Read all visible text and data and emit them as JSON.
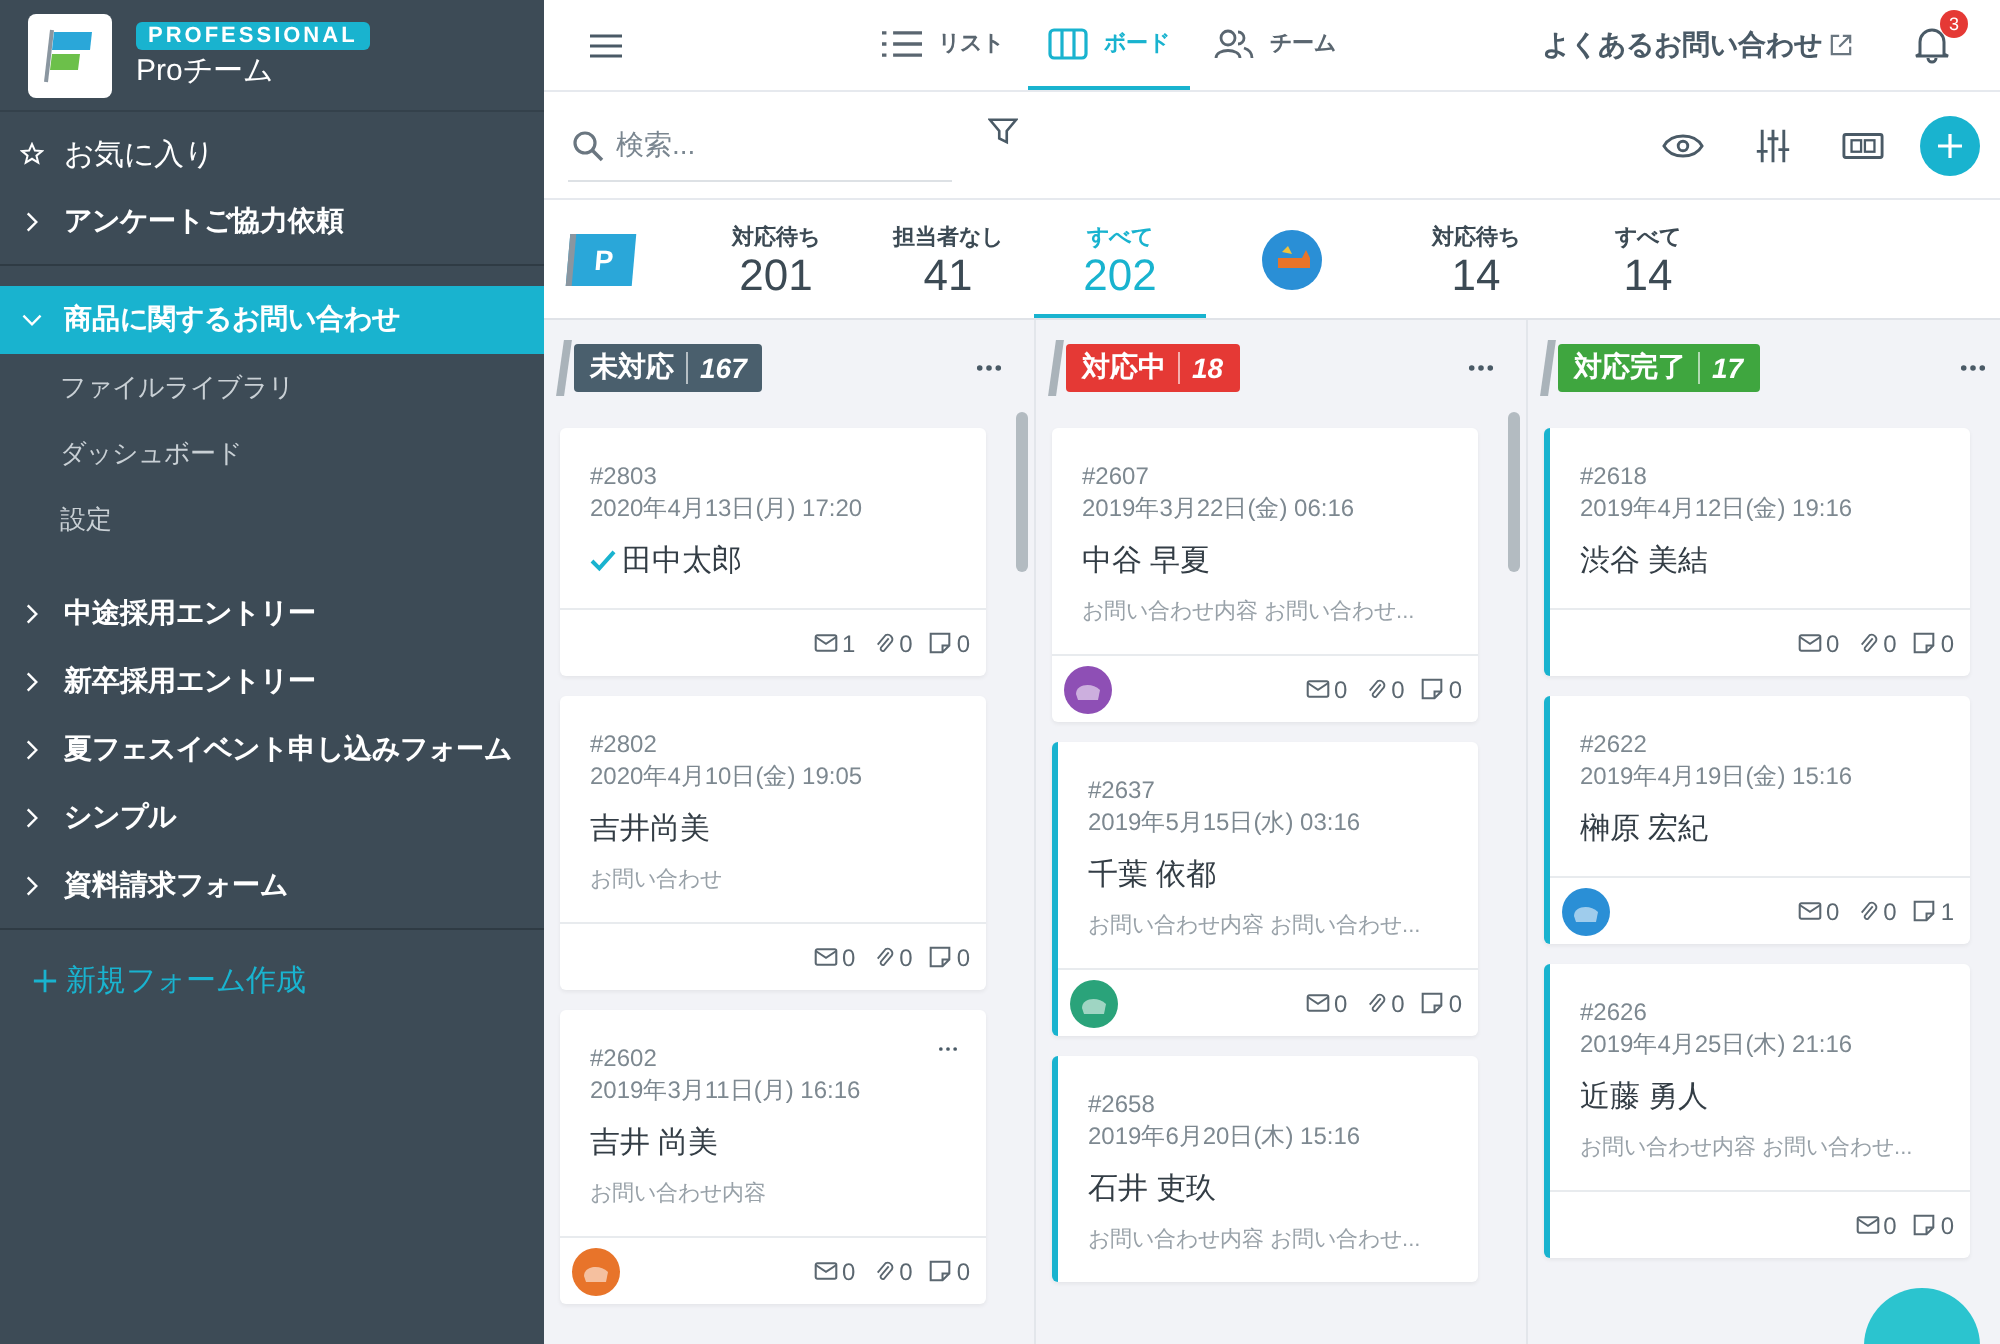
{
  "brand": {
    "badge": "PROFESSIONAL",
    "team": "Proチーム"
  },
  "sidebar": {
    "sections": [
      {
        "items": [
          {
            "kind": "favorites",
            "label": "お気に入り",
            "selected": false
          },
          {
            "kind": "form",
            "label": "アンケートご協力依頼",
            "expanded": false,
            "selected": false
          }
        ]
      },
      {
        "items": [
          {
            "kind": "form",
            "label": "商品に関するお問い合わせ",
            "expanded": true,
            "selected": true,
            "children": [
              {
                "label": "ファイルライブラリ"
              },
              {
                "label": "ダッシュボード"
              },
              {
                "label": "設定"
              }
            ]
          },
          {
            "kind": "form",
            "label": "中途採用エントリー",
            "expanded": false,
            "selected": false
          },
          {
            "kind": "form",
            "label": "新卒採用エントリー",
            "expanded": false,
            "selected": false
          },
          {
            "kind": "form",
            "label": "夏フェスイベント申し込みフォーム",
            "expanded": false,
            "selected": false
          },
          {
            "kind": "form",
            "label": "シンプル",
            "expanded": false,
            "selected": false
          },
          {
            "kind": "form",
            "label": "資料請求フォーム",
            "expanded": false,
            "selected": false
          }
        ]
      }
    ],
    "new_form": "新規フォーム作成"
  },
  "nav": {
    "tabs": [
      {
        "kind": "list",
        "label": "リスト",
        "selected": false
      },
      {
        "kind": "board",
        "label": "ボード",
        "selected": true
      },
      {
        "kind": "team",
        "label": "チーム",
        "selected": false
      }
    ],
    "help": "よくあるお問い合わせ",
    "notifications": "3"
  },
  "search": {
    "placeholder": "検索..."
  },
  "stats": [
    {
      "kind": "team",
      "mark": "P",
      "items": [
        {
          "label": "対応待ち",
          "value": "201",
          "selected": false
        },
        {
          "label": "担当者なし",
          "value": "41",
          "selected": false
        },
        {
          "label": "すべて",
          "value": "202",
          "selected": true
        }
      ]
    },
    {
      "kind": "user",
      "avatar": {
        "color": "#2a8fd6"
      },
      "items": [
        {
          "label": "対応待ち",
          "value": "14",
          "selected": false
        },
        {
          "label": "すべて",
          "value": "14",
          "selected": false
        }
      ]
    }
  ],
  "columns": [
    {
      "title": "未対応",
      "count": "167",
      "color": "#4a5f6d",
      "cards": [
        {
          "id": "#2803",
          "date": "2020年4月13日(月) 17:20",
          "name": "田中太郎",
          "checked": true,
          "marked": false,
          "mail": "1",
          "attach": "0",
          "notes": "0"
        },
        {
          "id": "#2802",
          "date": "2020年4月10日(金) 19:05",
          "name": "吉井尚美",
          "preview": "お問い合わせ",
          "marked": false,
          "mail": "0",
          "attach": "0",
          "notes": "0"
        },
        {
          "id": "#2602",
          "date": "2019年3月11日(月) 16:16",
          "name": "吉井 尚美",
          "preview": "お問い合わせ内容",
          "marked": false,
          "hovered": true,
          "avatar": {
            "color": "#e8742a"
          },
          "mail": "0",
          "attach": "0",
          "notes": "0"
        }
      ]
    },
    {
      "title": "対応中",
      "count": "18",
      "color": "#e53935",
      "cards": [
        {
          "id": "#2607",
          "date": "2019年3月22日(金) 06:16",
          "name": "中谷 早夏",
          "preview": "お問い合わせ内容 お問い合わせ...",
          "marked": false,
          "avatar": {
            "color": "#8e4fb5"
          },
          "mail": "0",
          "attach": "0",
          "notes": "0"
        },
        {
          "id": "#2637",
          "date": "2019年5月15日(水) 03:16",
          "name": "千葉 依都",
          "preview": "お問い合わせ内容 お問い合わせ...",
          "marked": true,
          "avatar": {
            "color": "#2aa37a"
          },
          "mail": "0",
          "attach": "0",
          "notes": "0"
        },
        {
          "id": "#2658",
          "date": "2019年6月20日(木) 15:16",
          "name": "石井 吏玖",
          "preview": "お問い合わせ内容 お問い合わせ...",
          "marked": true
        }
      ]
    },
    {
      "title": "対応完了",
      "count": "17",
      "color": "#3fa63f",
      "cards": [
        {
          "id": "#2618",
          "date": "2019年4月12日(金) 19:16",
          "name": "渋谷 美結",
          "marked": true,
          "mail": "0",
          "attach": "0",
          "notes": "0"
        },
        {
          "id": "#2622",
          "date": "2019年4月19日(金) 15:16",
          "name": "榊原 宏紀",
          "marked": true,
          "avatar": {
            "color": "#2a8fd6"
          },
          "mail": "0",
          "attach": "0",
          "notes": "1"
        },
        {
          "id": "#2626",
          "date": "2019年4月25日(木) 21:16",
          "name": "近藤 勇人",
          "preview": "お問い合わせ内容 お問い合わせ...",
          "marked": true,
          "mail": "0",
          "notes": "0"
        }
      ]
    }
  ]
}
